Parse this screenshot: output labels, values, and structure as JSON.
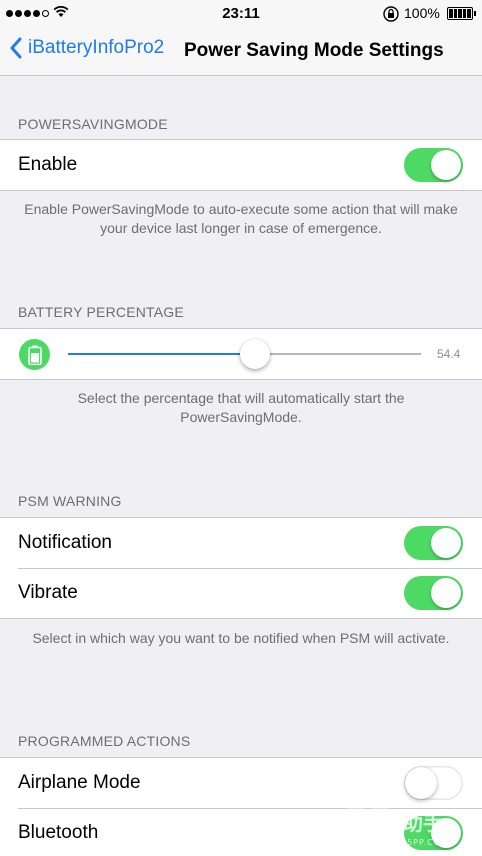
{
  "status_bar": {
    "time": "23:11",
    "battery_percent": "100%"
  },
  "nav": {
    "back_label": "iBatteryInfoPro2",
    "title": "Power Saving Mode Settings"
  },
  "sections": {
    "psm": {
      "header": "POWERSAVINGMODE",
      "enable_label": "Enable",
      "enable_on": true,
      "footer": "Enable PowerSavingMode to auto-execute some action that will make your device last longer in case of emergence."
    },
    "battery": {
      "header": "BATTERY PERCENTAGE",
      "value": "54.4",
      "slider_fraction": 0.53,
      "footer": "Select the percentage that will automatically start the PowerSavingMode."
    },
    "warning": {
      "header": "PSM WARNING",
      "notification_label": "Notification",
      "notification_on": true,
      "vibrate_label": "Vibrate",
      "vibrate_on": true,
      "footer": "Select in which way you want to be notified when PSM will activate."
    },
    "actions": {
      "header": "PROGRAMMED ACTIONS",
      "airplane_label": "Airplane Mode",
      "airplane_on": false,
      "bluetooth_label": "Bluetooth",
      "bluetooth_on": true
    }
  },
  "watermark": {
    "text": "PP助手",
    "subtext": "25PP.COM"
  },
  "colors": {
    "accent": "#1f7ce8",
    "toggle_on": "#4cd964",
    "background": "#efeff4"
  }
}
